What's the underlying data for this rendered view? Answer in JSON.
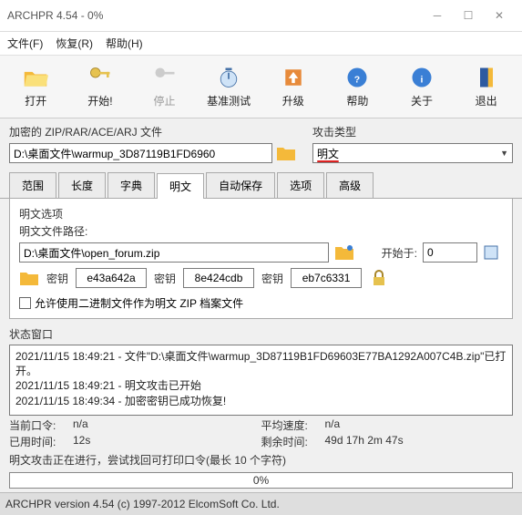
{
  "title": "ARCHPR 4.54 - 0%",
  "menu": {
    "file": "文件(F)",
    "recover": "恢复(R)",
    "help": "帮助(H)"
  },
  "toolbar": {
    "open": "打开",
    "start": "开始!",
    "stop": "停止",
    "benchmark": "基准测试",
    "upgrade": "升级",
    "helpbtn": "帮助",
    "about": "关于",
    "exit": "退出"
  },
  "params": {
    "left_label": "加密的 ZIP/RAR/ACE/ARJ 文件",
    "left_value": "D:\\桌面文件\\warmup_3D87119B1FD6960",
    "right_label": "攻击类型",
    "right_value": "明文"
  },
  "tabs": [
    "范围",
    "长度",
    "字典",
    "明文",
    "自动保存",
    "选项",
    "高级"
  ],
  "panel": {
    "title": "明文选项",
    "path_label": "明文文件路径:",
    "path_value": "D:\\桌面文件\\open_forum.zip",
    "start_at_label": "开始于:",
    "start_at_value": "0",
    "key_label": "密钥",
    "keys": [
      "e43a642a",
      "8e424cdb",
      "eb7c6331"
    ],
    "allow_binary": "允许使用二进制文件作为明文 ZIP 档案文件"
  },
  "status": {
    "title": "状态窗口",
    "lines": [
      "2021/11/15 18:49:21 - 文件\"D:\\桌面文件\\warmup_3D87119B1FD69603E77BA1292A007C4B.zip\"已打开。",
      "2021/11/15 18:49:21 - 明文攻击已开始",
      "2021/11/15 18:49:34 - 加密密钥已成功恢复!"
    ]
  },
  "stats": {
    "pw_k": "当前口令:",
    "pw_v": "n/a",
    "sp_k": "平均速度:",
    "sp_v": "n/a",
    "el_k": "已用时间:",
    "el_v": "12s",
    "rm_k": "剩余时间:",
    "rm_v": "49d 17h 2m 47s",
    "msg": "明文攻击正在进行，尝试找回可打印口令(最长 10 个字符)"
  },
  "progress": "0%",
  "statusbar": "ARCHPR version 4.54 (c) 1997-2012 ElcomSoft Co. Ltd."
}
